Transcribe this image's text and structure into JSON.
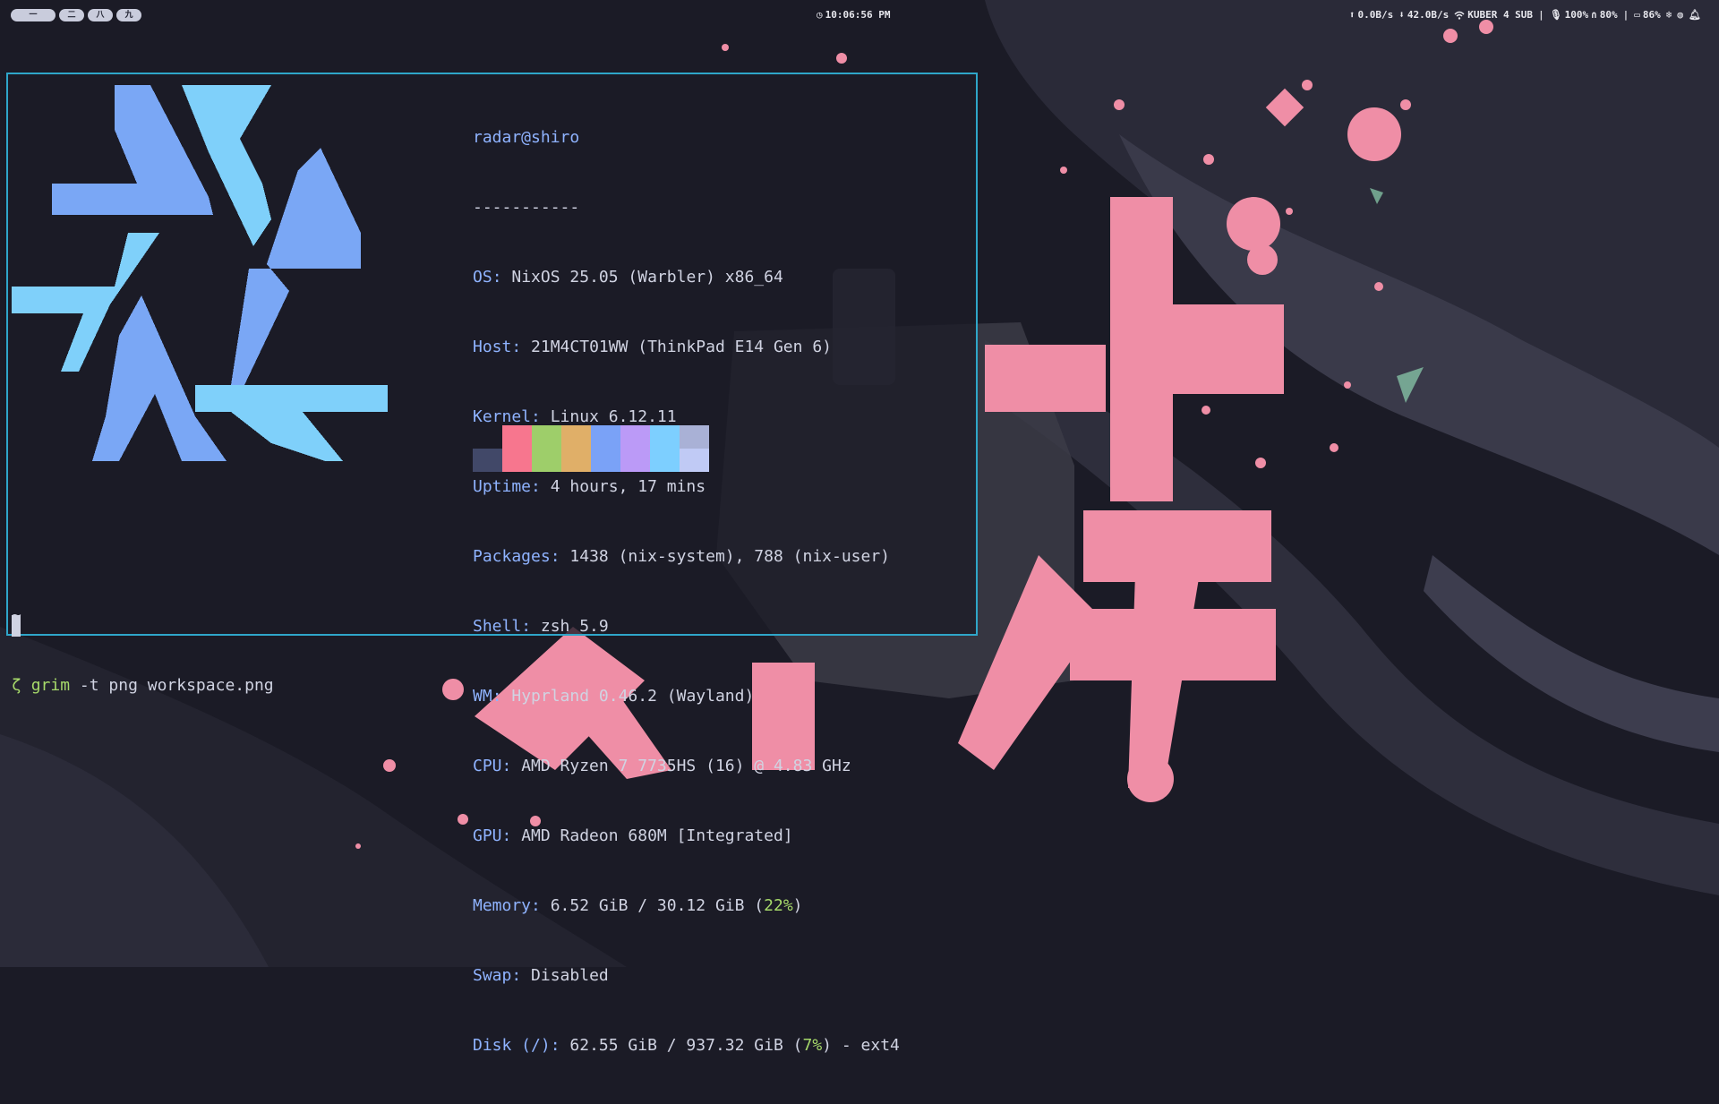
{
  "bar": {
    "workspaces": [
      {
        "label": "一",
        "active": true
      },
      {
        "label": "二",
        "active": false
      },
      {
        "label": "八",
        "active": false
      },
      {
        "label": "九",
        "active": false
      }
    ],
    "clock": {
      "icon": "clock-icon",
      "time": "10:06:56 PM"
    },
    "network": {
      "upload": "0.0B/s",
      "download": "42.0B/s",
      "wifi_icon": "wifi-icon",
      "ssid": "KUBER 4 SUB"
    },
    "audio": {
      "mic": "100%",
      "headphones": "80%"
    },
    "battery": "86%",
    "tray_icons": [
      "nix-icon",
      "steam-icon",
      "bell-icon"
    ]
  },
  "terminal": {
    "title": "radar@shiro",
    "separator": "-----------",
    "fields": [
      {
        "key": "OS",
        "value": "NixOS 25.05 (Warbler) x86_64"
      },
      {
        "key": "Host",
        "value": "21M4CT01WW (ThinkPad E14 Gen 6)"
      },
      {
        "key": "Kernel",
        "value": "Linux 6.12.11"
      },
      {
        "key": "Uptime",
        "value": "4 hours, 17 mins"
      },
      {
        "key": "Packages",
        "value": "1438 (nix-system), 788 (nix-user)"
      },
      {
        "key": "Shell",
        "value": "zsh 5.9"
      },
      {
        "key": "WM",
        "value": "Hyprland 0.46.2 (Wayland)"
      },
      {
        "key": "CPU",
        "value": "AMD Ryzen 7 7735HS (16) @ 4.83 GHz"
      },
      {
        "key": "GPU",
        "value": "AMD Radeon 680M [Integrated]"
      },
      {
        "key": "Memory",
        "value": "6.52 GiB / 30.12 GiB (",
        "pct": "22%",
        "tail": ")"
      },
      {
        "key": "Swap",
        "value": "Disabled"
      },
      {
        "key": "Disk (/)",
        "value": "62.55 GiB / 937.32 GiB (",
        "pct": "7%",
        "tail": ") - ext4"
      }
    ],
    "palette_top": [
      "#1b1b26",
      "#f7768e",
      "#9ece6a",
      "#e0af68",
      "#7aa2f7",
      "#bb9af7",
      "#7dcfff",
      "#a9b1d6"
    ],
    "palette_bottom": [
      "#414868",
      "#f7768e",
      "#9ece6a",
      "#e0af68",
      "#7aa2f7",
      "#bb9af7",
      "#7dcfff",
      "#c0caf5"
    ],
    "prompt": {
      "dir": "~",
      "arrow": "ζ",
      "command": "grim",
      "args": " -t png workspace.png"
    },
    "colors": {
      "border": "#2fa6c9",
      "key": "#8fb3ff",
      "accent_green": "#a6d96a",
      "logo_dark": "#7aa7f5",
      "logo_light": "#7fd0fa"
    }
  },
  "wallpaper": {
    "accent_pink": "#ef8ea6",
    "bg": "#1b1b26"
  }
}
